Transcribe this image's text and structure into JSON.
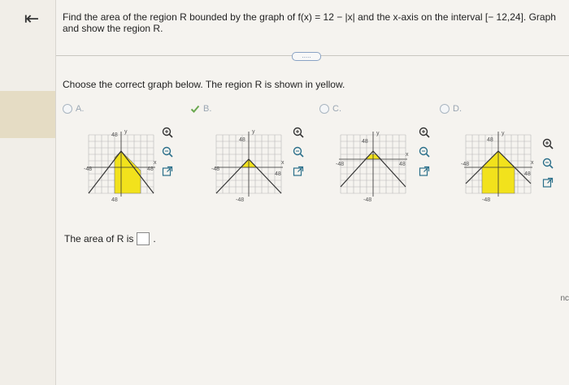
{
  "nav": {
    "back_icon": "back-arrow-icon"
  },
  "question": {
    "text": "Find the area of the region R bounded by the graph of f(x) = 12 − |x| and the x-axis on the interval [− 12,24]. Graph and show the region R."
  },
  "more_button": {
    "label": "....."
  },
  "prompt": "Choose the correct graph below. The region R is shown in yellow.",
  "options": [
    {
      "letter": "A.",
      "selected": false,
      "top_label": "48",
      "left_label": "-48",
      "right_label": "48",
      "bottom_label": "48",
      "y_label": "y",
      "x_label": "x"
    },
    {
      "letter": "B.",
      "selected": true,
      "top_label": "48",
      "left_label": "-48",
      "right_label": "48",
      "bottom_label": "-48",
      "y_label": "y",
      "x_label": "x"
    },
    {
      "letter": "C.",
      "selected": false,
      "top_label": "48",
      "left_label": "-48",
      "right_label": "48",
      "bottom_label": "-48",
      "y_label": "y",
      "x_label": "x"
    },
    {
      "letter": "D.",
      "selected": false,
      "top_label": "48",
      "left_label": "-48",
      "right_label": "48",
      "bottom_label": "-48",
      "y_label": "y",
      "x_label": "x"
    }
  ],
  "answer": {
    "label": "The area of R is",
    "suffix": ".",
    "value": ""
  },
  "edge_text": "nc",
  "colors": {
    "yellow": "#f2e21c",
    "accent": "#2b5c8a",
    "check": "#6aa84f"
  }
}
